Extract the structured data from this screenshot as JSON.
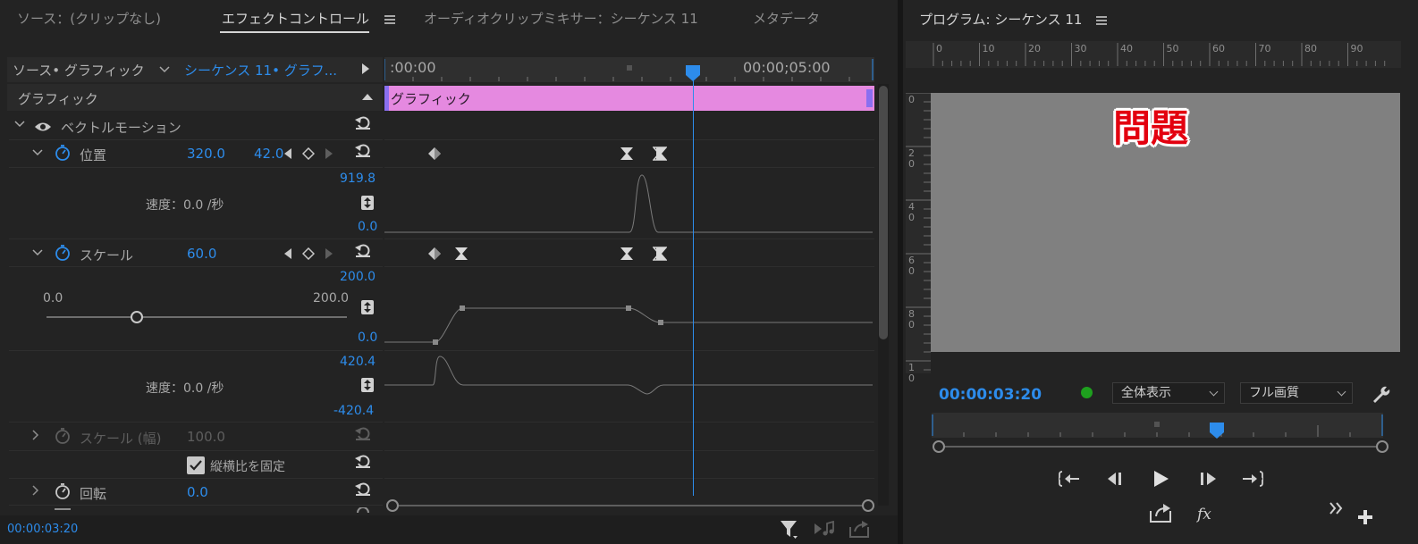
{
  "left_tabs": {
    "source": "ソース：(クリップなし)",
    "effect_controls": "エフェクトコントロール",
    "audio_mixer": "オーディオクリップミキサー：シーケンス 11",
    "metadata": "メタデータ"
  },
  "subheader": {
    "source_clip": "ソース• グラフィック",
    "sequence_clip": "シーケンス 11• グラフ..."
  },
  "timeline": {
    "start_time": ":00:00",
    "end_time": "00:00;05:00",
    "clip_name": "グラフィック"
  },
  "section": {
    "title": "グラフィック"
  },
  "vector_motion": {
    "label": "ベクトルモーション"
  },
  "position": {
    "label": "位置",
    "x": "320.0",
    "y": "42.0",
    "graph_max": "919.8",
    "graph_min": "0.0",
    "velocity": "速度：0.0 /秒"
  },
  "scale": {
    "label": "スケール",
    "value": "60.0",
    "slider_min": "0.0",
    "slider_max": "200.0",
    "slider_value_fraction": 0.3,
    "graph_max": "200.0",
    "graph_min": "0.0",
    "vel_max": "420.4",
    "vel_min": "-420.4",
    "velocity": "速度：0.0 /秒"
  },
  "scale_width": {
    "label": "スケール (幅)",
    "value": "100.0"
  },
  "uniform_scale": {
    "label": "縦横比を固定",
    "checked": true
  },
  "rotation": {
    "label": "回転",
    "value": "0.0"
  },
  "footer": {
    "timecode": "00:00:03:20"
  },
  "program": {
    "title": "プログラム: シーケンス 11",
    "ruler_top": [
      "0",
      "10",
      "20",
      "30",
      "40",
      "50",
      "60",
      "70",
      "80",
      "90"
    ],
    "ruler_left": [
      "0",
      "2 0",
      "4 0",
      "6 0",
      "8 0",
      "1 0"
    ],
    "overlay_text": "問題",
    "timecode": "00:00:03:20",
    "zoom": "全体表示",
    "quality": "フル画質"
  },
  "colors": {
    "accent": "#2d8ceb",
    "clip": "#e589e0",
    "overlay_text": "#e3000f",
    "status_dot": "#1ea01e",
    "preview_bg": "#808080"
  },
  "icons": {
    "eye": "eye-icon",
    "stopwatch": "stopwatch-icon",
    "reset": "reset-icon",
    "filter": "filter-icon",
    "wrench": "wrench-icon",
    "play": "play-icon"
  }
}
